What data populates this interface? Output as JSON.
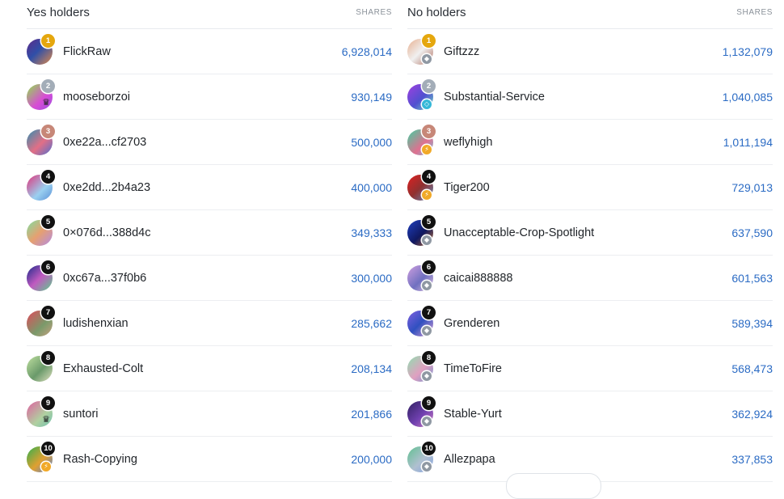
{
  "yes": {
    "title": "Yes holders",
    "shares_label": "SHARES",
    "rows": [
      {
        "rank": "1",
        "name": "FlickRaw",
        "shares": "6,928,014",
        "badge": "",
        "avatar": "linear-gradient(135deg,#5f2a88 0%,#2f4fa8 45%,#e08a4a 100%)"
      },
      {
        "rank": "2",
        "name": "mooseborzoi",
        "shares": "930,149",
        "badge": "crown",
        "avatar": "linear-gradient(135deg,#8fe24c 0%,#d84bd6 60%,#9c4fe0 100%)"
      },
      {
        "rank": "3",
        "name": "0xe22a...cf2703",
        "shares": "500,000",
        "badge": "",
        "avatar": "linear-gradient(135deg,#2f8fb0 0%,#e26f86 55%,#4e6fd0 100%)"
      },
      {
        "rank": "4",
        "name": "0xe2dd...2b4a23",
        "shares": "400,000",
        "badge": "",
        "avatar": "linear-gradient(135deg,#e0327a 0%,#9ad0f0 60%,#5a8fd6 100%)"
      },
      {
        "rank": "5",
        "name": "0×076d...388d4c",
        "shares": "349,333",
        "badge": "",
        "avatar": "linear-gradient(135deg,#7fe0a0 0%,#e6a070 50%,#b28be6 100%)"
      },
      {
        "rank": "6",
        "name": "0xc67a...37f0b6",
        "shares": "300,000",
        "badge": "",
        "avatar": "linear-gradient(135deg,#1a2a8a 0%,#c05ac0 50%,#5ad08a 100%)"
      },
      {
        "rank": "7",
        "name": "ludishenxian",
        "shares": "285,662",
        "badge": "",
        "avatar": "linear-gradient(135deg,#e04a5a 0%,#7a9a6a 60%,#c8a080 100%)"
      },
      {
        "rank": "8",
        "name": "Exhausted-Colt",
        "shares": "208,134",
        "badge": "",
        "avatar": "linear-gradient(135deg,#c0e0a0 0%,#6a9a6a 55%,#e0e0c0 100%)"
      },
      {
        "rank": "9",
        "name": "suntori",
        "shares": "201,866",
        "badge": "crown",
        "avatar": "linear-gradient(135deg,#e060a0 0%,#b0d0a0 60%,#70c0b0 100%)"
      },
      {
        "rank": "10",
        "name": "Rash-Copying",
        "shares": "200,000",
        "badge": "bolt",
        "avatar": "linear-gradient(135deg,#30b050 0%,#e0a030 55%,#5080e0 100%)"
      }
    ]
  },
  "no": {
    "title": "No holders",
    "shares_label": "SHARES",
    "rows": [
      {
        "rank": "1",
        "name": "Giftzzz",
        "shares": "1,132,079",
        "badge": "shield",
        "avatar": "linear-gradient(135deg,#e8b090 0%,#f0f0f0 50%,#b07060 100%)"
      },
      {
        "rank": "2",
        "name": "Substantial-Service",
        "shares": "1,040,085",
        "badge": "diamond",
        "avatar": "linear-gradient(135deg,#a040e0 0%,#5050d0 55%,#70e0c0 100%)"
      },
      {
        "rank": "3",
        "name": "weflyhigh",
        "shares": "1,011,194",
        "badge": "bolt",
        "avatar": "linear-gradient(135deg,#40d0a0 0%,#e07090 60%,#70c0e0 100%)"
      },
      {
        "rank": "4",
        "name": "Tiger200",
        "shares": "729,013",
        "badge": "bolt",
        "avatar": "linear-gradient(135deg,#e02020 0%,#903030 50%,#6090c0 100%)"
      },
      {
        "rank": "5",
        "name": "Unacceptable-Crop-Spotlight",
        "shares": "637,590",
        "badge": "shield",
        "avatar": "linear-gradient(135deg,#2040c0 0%,#101860 55%,#c07030 100%)"
      },
      {
        "rank": "6",
        "name": "caicai888888",
        "shares": "601,563",
        "badge": "shield",
        "avatar": "linear-gradient(135deg,#d0a0e0 0%,#7070c0 55%,#e0c0e0 100%)"
      },
      {
        "rank": "7",
        "name": "Grenderen",
        "shares": "589,394",
        "badge": "shield",
        "avatar": "linear-gradient(135deg,#8060e0 0%,#3050c0 50%,#e0a0d0 100%)"
      },
      {
        "rank": "8",
        "name": "TimeToFire",
        "shares": "568,473",
        "badge": "shield",
        "avatar": "linear-gradient(135deg,#90e0b0 0%,#e0a0c0 55%,#7090d0 100%)"
      },
      {
        "rank": "9",
        "name": "Stable-Yurt",
        "shares": "362,924",
        "badge": "shield",
        "avatar": "linear-gradient(135deg,#302060 0%,#7040b0 55%,#d080c0 100%)"
      },
      {
        "rank": "10",
        "name": "Allezpapa",
        "shares": "337,853",
        "badge": "shield",
        "avatar": "linear-gradient(135deg,#60c090 0%,#b0c0d0 55%,#80a0e0 100%)"
      }
    ]
  },
  "colors": {
    "accent": "#2b6bc4",
    "rank_gold": "#e5a70e",
    "rank_silver": "#a3adb8",
    "rank_bronze": "#c78778",
    "rank_default": "#111111"
  }
}
